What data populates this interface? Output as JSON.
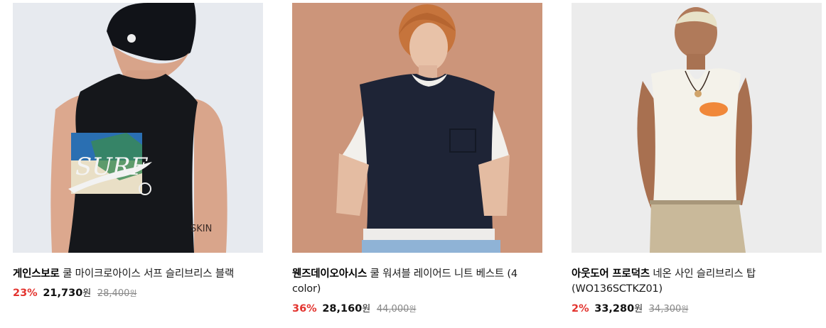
{
  "products": [
    {
      "brand": "게인스보로",
      "name": "쿨 마이크로아이스 서프 슬리브리스 블랙",
      "discount": "23%",
      "sale_price": "21,730",
      "original_price": "28,400",
      "currency": "원",
      "image_icon": "sleeveless-tank-photo"
    },
    {
      "brand": "웬즈데이오아시스",
      "name": "쿨 워셔블 레이어드 니트 베스트 (4 color)",
      "discount": "36%",
      "sale_price": "28,160",
      "original_price": "44,000",
      "currency": "원",
      "image_icon": "knit-vest-photo"
    },
    {
      "brand": "아웃도어 프로덕츠",
      "name": "네온 사인 슬리브리스 탑 (WO136SCTKZ01)",
      "discount": "2%",
      "sale_price": "33,280",
      "original_price": "34,300",
      "currency": "원",
      "image_icon": "sleeveless-top-photo"
    }
  ],
  "image_text": {
    "print": "SURF",
    "tattoo": "SKIN"
  },
  "colors": {
    "discount": "#e3342f",
    "original_price": "#888888",
    "brand": "#000000"
  }
}
